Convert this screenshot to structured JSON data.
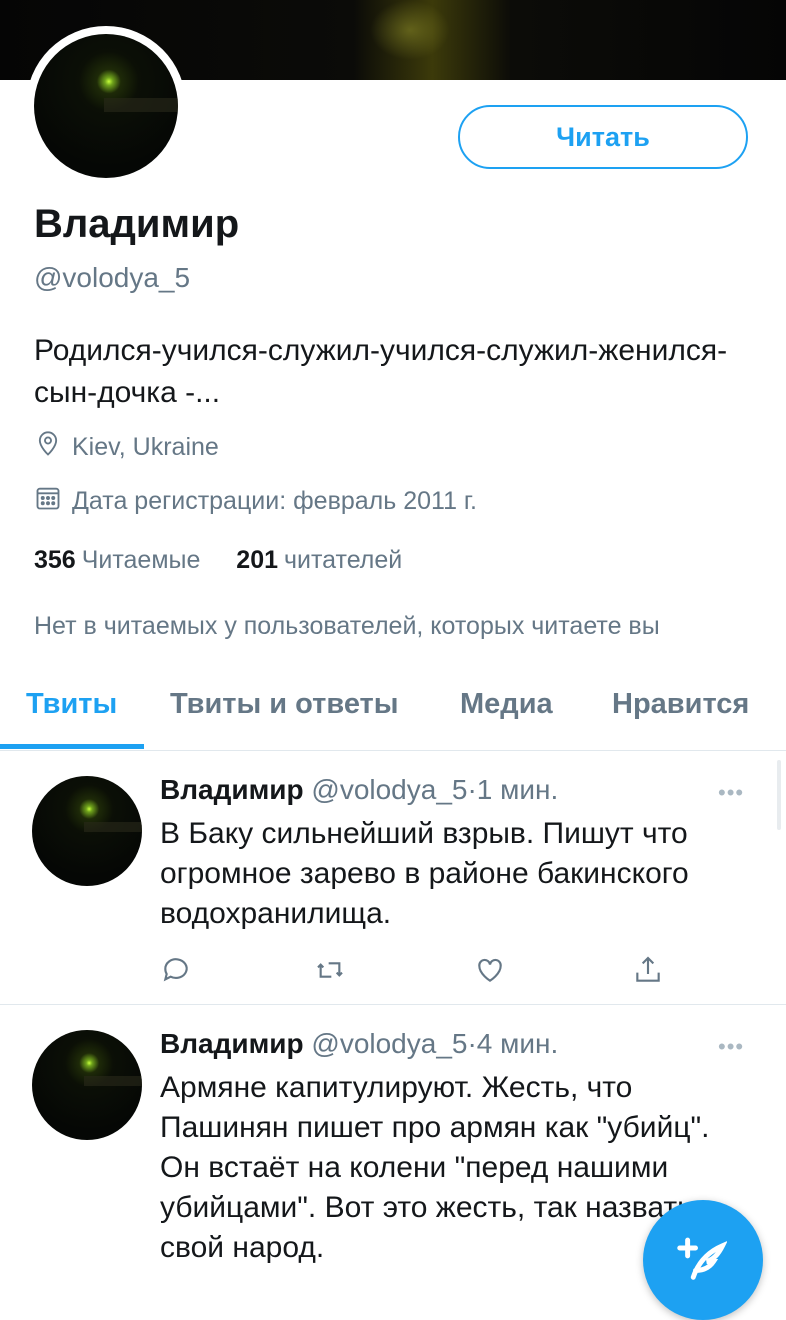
{
  "profile": {
    "follow_label": "Читать",
    "name": "Владимир",
    "handle": "@volodya_5",
    "bio": "Родился-учился-служил-учился-служил-женился-сын-дочка -...",
    "location": "Kiev, Ukraine",
    "joined": "Дата регистрации: февраль 2011 г.",
    "following_count": "356",
    "following_label": "Читаемые",
    "followers_count": "201",
    "followers_label": "читателей",
    "mutual_text": "Нет в читаемых у пользователей, которых читаете вы"
  },
  "tabs": [
    {
      "label": "Твиты",
      "active": true
    },
    {
      "label": "Твиты и ответы",
      "active": false
    },
    {
      "label": "Медиа",
      "active": false
    },
    {
      "label": "Нравится",
      "active": false
    }
  ],
  "tweets": [
    {
      "name": "Владимир",
      "handle": "@volodya_5",
      "dot": "·",
      "time": "1 мин.",
      "more": "•••",
      "text": "В Баку сильнейший взрыв. Пишут что огромное зарево в районе бакинского водохранилища."
    },
    {
      "name": "Владимир",
      "handle": "@volodya_5",
      "dot": "·",
      "time": "4 мин.",
      "more": "•••",
      "text": "Армяне капитулируют. Жесть, что Пашинян пишет про армян как \"убийц\". Он встаёт на колени \"перед нашими убийцами\". Вот это жесть, так назвать свой народ."
    }
  ],
  "icons": {
    "location": "location-pin-icon",
    "calendar": "calendar-icon",
    "reply": "reply-icon",
    "retweet": "retweet-icon",
    "like": "heart-icon",
    "share": "share-icon",
    "compose": "compose-tweet-icon"
  },
  "colors": {
    "accent": "#1da1f2",
    "secondary_text": "#657786",
    "primary_text": "#14171a"
  }
}
